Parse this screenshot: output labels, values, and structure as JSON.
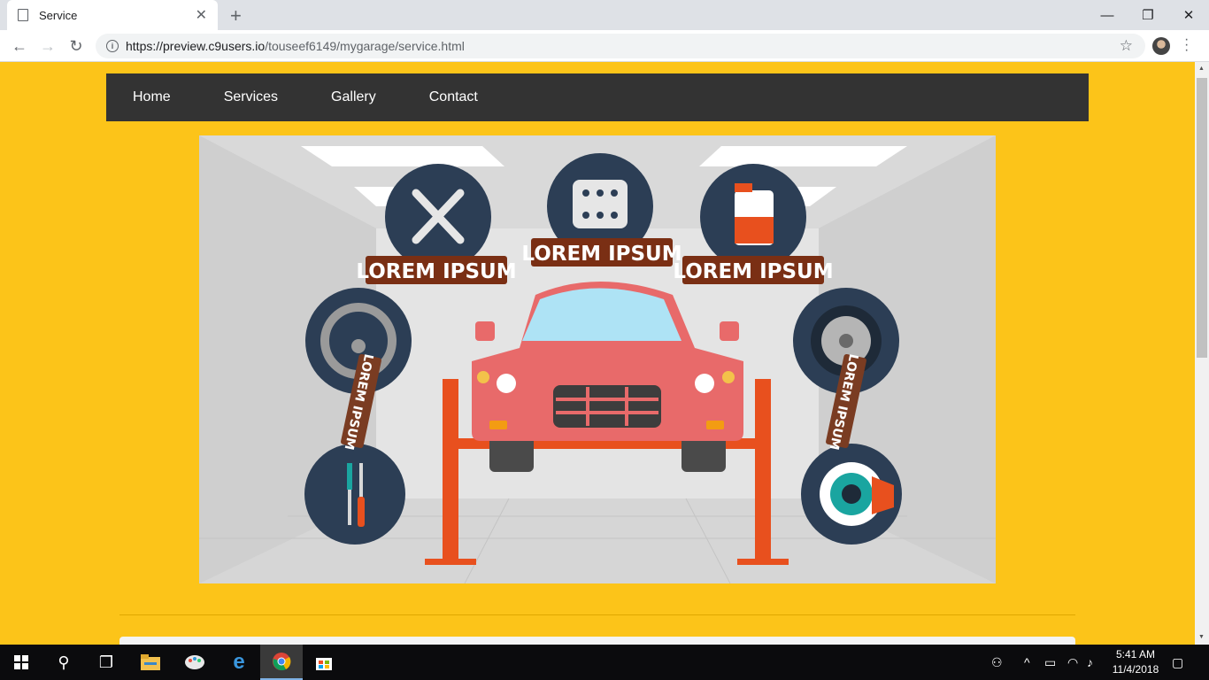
{
  "browser": {
    "tab_title": "Service",
    "url_host": "https://preview.c9users.io",
    "url_path": "/touseef6149/mygarage/service.html"
  },
  "nav": {
    "items": [
      "Home",
      "Services",
      "Gallery",
      "Contact"
    ]
  },
  "hero": {
    "labels": [
      "LOREM IPSUM",
      "LOREM IPSUM",
      "LOREM IPSUM",
      "LOREM IPSUM",
      "LOREM IPSUM"
    ]
  },
  "taskbar": {
    "time": "5:41 AM",
    "date": "11/4/2018"
  },
  "colors": {
    "page_bg": "#fcc419",
    "navbar_bg": "#333333",
    "badge_dark": "#2c3e55",
    "banner": "#7a2f14",
    "car": "#e86a6a",
    "lift": "#e8501e"
  }
}
